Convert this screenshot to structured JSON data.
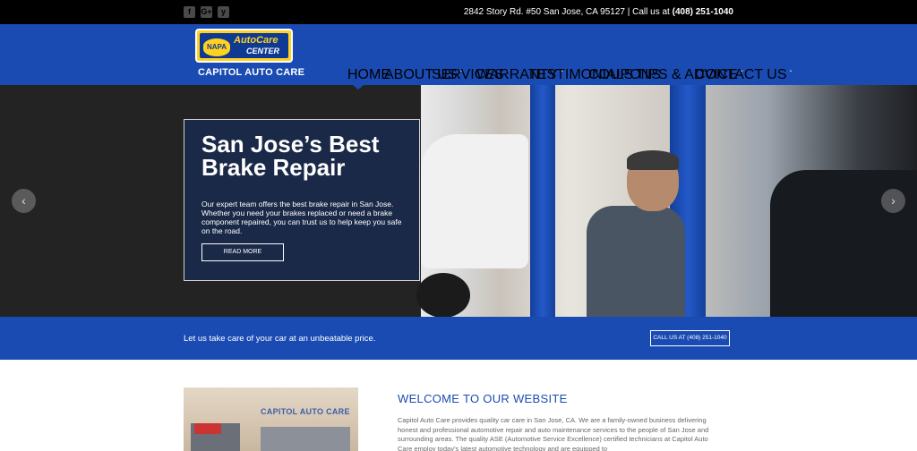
{
  "topbar": {
    "social": [
      "f",
      "G+",
      "y"
    ],
    "address": "2842 Story Rd. #50 San Jose, CA 95127 | Call us at ",
    "phone": "(408) 251-1040"
  },
  "header": {
    "logo": {
      "napa": "NAPA",
      "autocare": "AutoCare",
      "center": "CENTER"
    },
    "brand": "CAPITOL AUTO CARE",
    "nav": [
      {
        "label": "HOME"
      },
      {
        "label": "ABOUT US"
      },
      {
        "label": "SERVICES"
      },
      {
        "label": "WARRANTY"
      },
      {
        "label": "TESTIMONIALS"
      },
      {
        "label": "COUPONS"
      },
      {
        "label": "TIPS & ADVICE"
      },
      {
        "label": "CONTACT US"
      }
    ]
  },
  "hero": {
    "title": "San Jose’s Best Brake Repair",
    "text": "Our expert team offers the best brake repair in San Jose. Whether you need your brakes replaced or need a brake component repaired, you can trust us to help keep you safe on the road.",
    "button": "READ MORE",
    "prev": "‹",
    "next": "›"
  },
  "cta": {
    "text": "Let us take care of your car at an unbeatable price.",
    "button": "CALL US AT (408) 251-1040"
  },
  "welcome": {
    "sign": "CAPITOL AUTO CARE",
    "title": "WELCOME TO OUR WEBSITE",
    "text": "Capitol Auto Care provides quality car care in San Jose, CA. We are a family-owned business delivering honest and professional automotive repair and auto maintenance services to the people of San Jose and surrounding areas. The quality ASE (Automotive Service Excellence) certified technicians at Capitol Auto Care employ today’s latest automotive technology and are equipped to"
  }
}
